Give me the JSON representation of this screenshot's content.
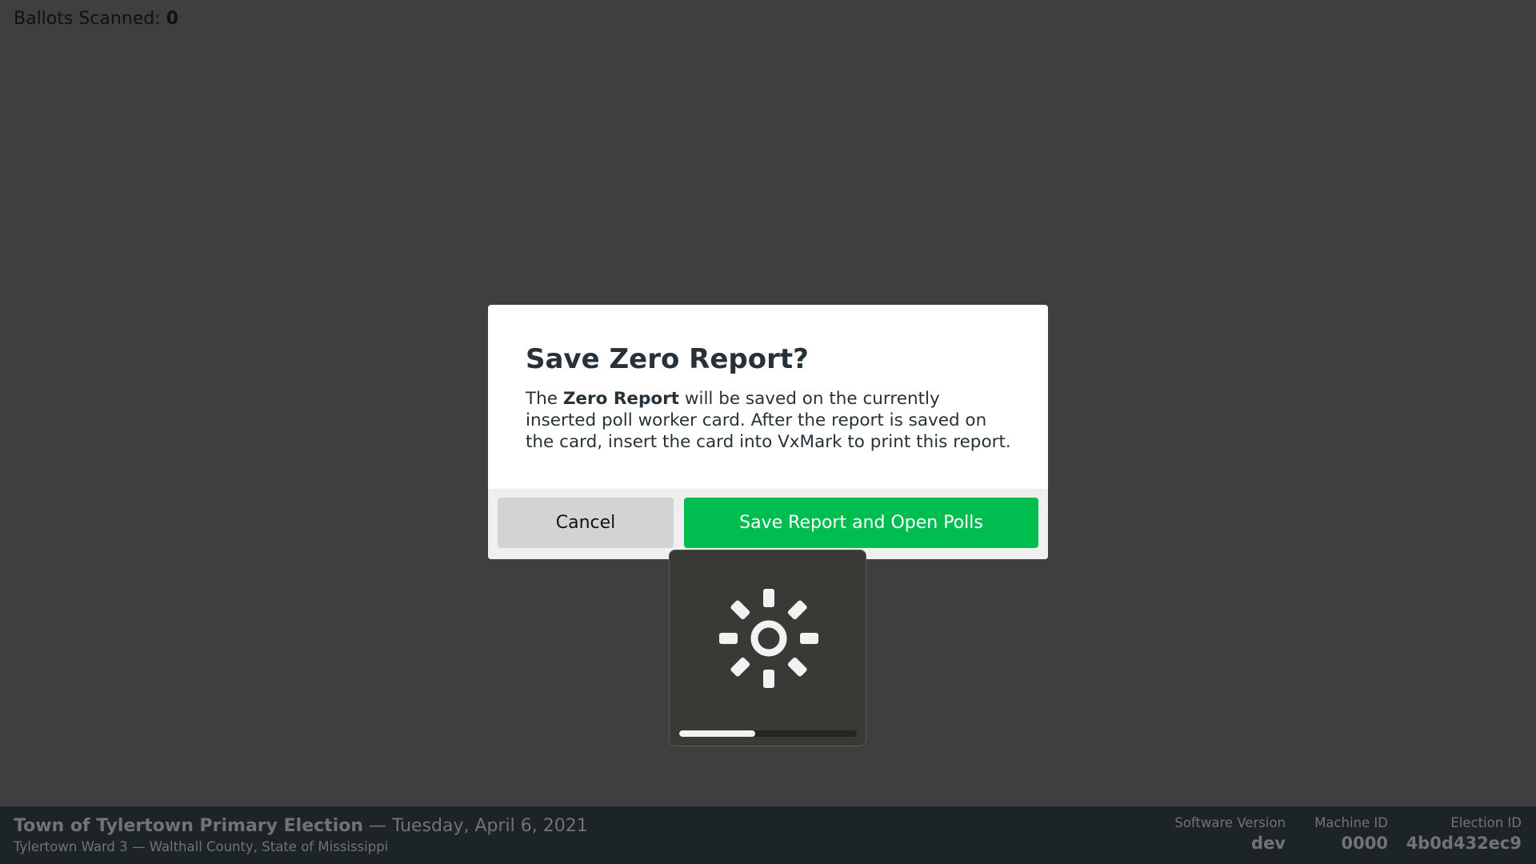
{
  "status": {
    "ballots_label": "Ballots Scanned:",
    "ballots_count": "0"
  },
  "modal": {
    "title": "Save Zero Report?",
    "body_prefix": "The ",
    "body_bold": "Zero Report",
    "body_suffix": " will be saved on the currently inserted poll worker card. After the report is saved on the card, insert the card into VxMark to print this report.",
    "cancel_label": "Cancel",
    "confirm_label": "Save Report and Open Polls"
  },
  "osd": {
    "icon": "brightness-icon",
    "level": 0.43
  },
  "footer": {
    "election_name": "Town of Tylertown Primary Election",
    "election_date": " — Tuesday, April 6, 2021",
    "precinct_line": "Tylertown Ward 3 — Walthall County, State of Mississippi",
    "software_version_label": "Software Version",
    "software_version": "dev",
    "machine_id_label": "Machine ID",
    "machine_id": "0000",
    "election_id_label": "Election ID",
    "election_id": "4b0d432ec9"
  },
  "colors": {
    "background": "#3f3f3f",
    "primary": "#00bd50",
    "cancel": "#d3d3d3",
    "footer": "#1d2427"
  }
}
